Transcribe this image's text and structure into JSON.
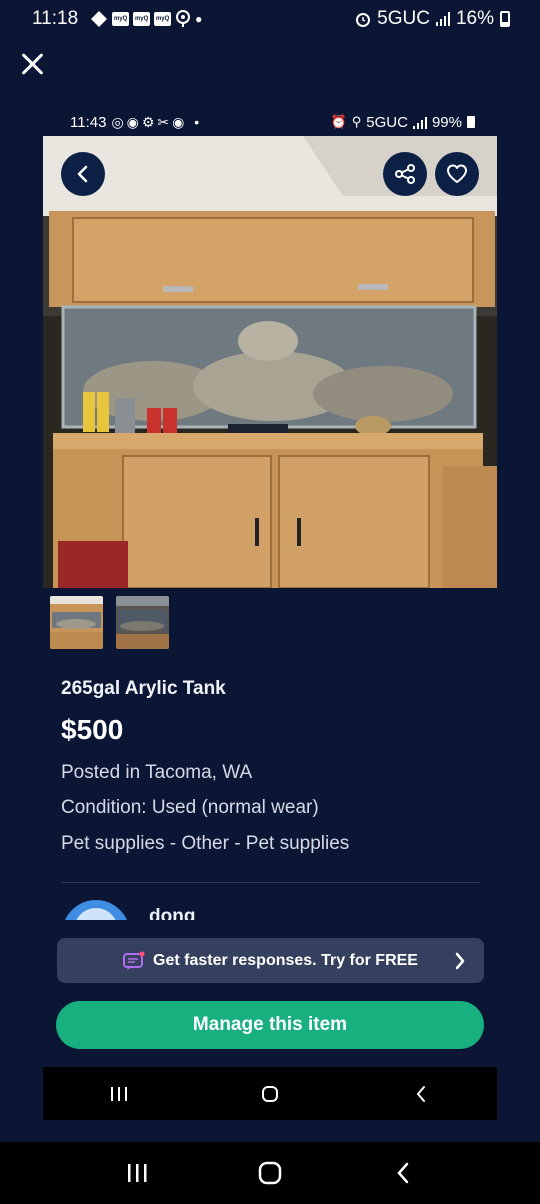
{
  "status_bar": {
    "time": "11:18",
    "network": "5GUC",
    "battery": "16%",
    "notif_label": "myQ"
  },
  "inner_status_bar": {
    "time": "11:43",
    "network": "5GUC",
    "battery": "99%"
  },
  "listing": {
    "title": "265gal Arylic Tank",
    "price": "$500",
    "location": "Posted in Tacoma, WA",
    "condition": "Condition: Used (normal wear)",
    "category": "Pet supplies - Other - Pet supplies"
  },
  "seller": {
    "name": "dong"
  },
  "promo": {
    "label": "Get faster responses. Try for FREE"
  },
  "actions": {
    "manage_label": "Manage this item"
  },
  "icons": {
    "close": "close-icon",
    "back": "chevron-left-icon",
    "share": "share-icon",
    "favorite": "heart-icon",
    "promo": "chat-bubble-icon",
    "nav_recents": "recents-icon",
    "nav_home": "home-icon",
    "nav_back": "back-icon"
  },
  "colors": {
    "background": "#0b1534",
    "accent_green": "#17b07e",
    "promo_bg": "#34405e",
    "button_bg": "#0c1f45"
  }
}
